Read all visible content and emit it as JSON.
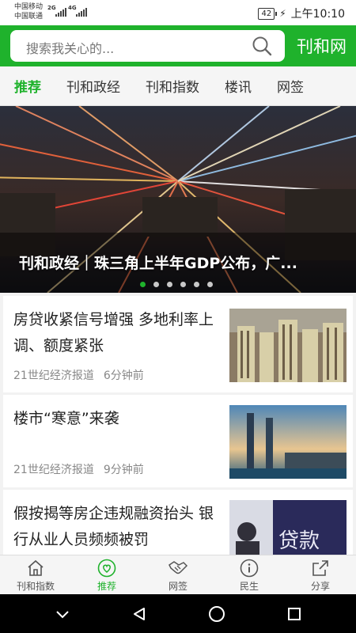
{
  "status_bar": {
    "carrier_1": "中国移动",
    "carrier_2": "中国联通",
    "network_1": "2G",
    "network_2": "4G",
    "battery": "42",
    "time": "上午10:10"
  },
  "header": {
    "search_placeholder": "搜索我关心的...",
    "brand": "刊和网",
    "accent_color": "#1fb22c"
  },
  "tabs": [
    {
      "label": "推荐",
      "active": true
    },
    {
      "label": "刊和政经",
      "active": false
    },
    {
      "label": "刊和指数",
      "active": false
    },
    {
      "label": "楼讯",
      "active": false
    },
    {
      "label": "网签",
      "active": false
    }
  ],
  "banner": {
    "caption": "刊和政经｜珠三角上半年GDP公布，广...",
    "slide_count": 6,
    "active_slide": 1
  },
  "articles": [
    {
      "title": "房贷收紧信号增强 多地利率上调、额度紧张",
      "source": "21世纪经济报道",
      "time": "6分钟前"
    },
    {
      "title": "楼市“寒意”来袭",
      "source": "21世纪经济报道",
      "time": "9分钟前"
    },
    {
      "title": "假按揭等房企违规融资抬头 银行从业人员频频被罚",
      "source": "",
      "time": ""
    }
  ],
  "bottom_nav": [
    {
      "label": "刊和指数",
      "icon": "home-icon",
      "active": false
    },
    {
      "label": "推荐",
      "icon": "heart-icon",
      "active": true
    },
    {
      "label": "网签",
      "icon": "handshake-icon",
      "active": false
    },
    {
      "label": "民生",
      "icon": "info-icon",
      "active": false
    },
    {
      "label": "分享",
      "icon": "share-icon",
      "active": false
    }
  ]
}
